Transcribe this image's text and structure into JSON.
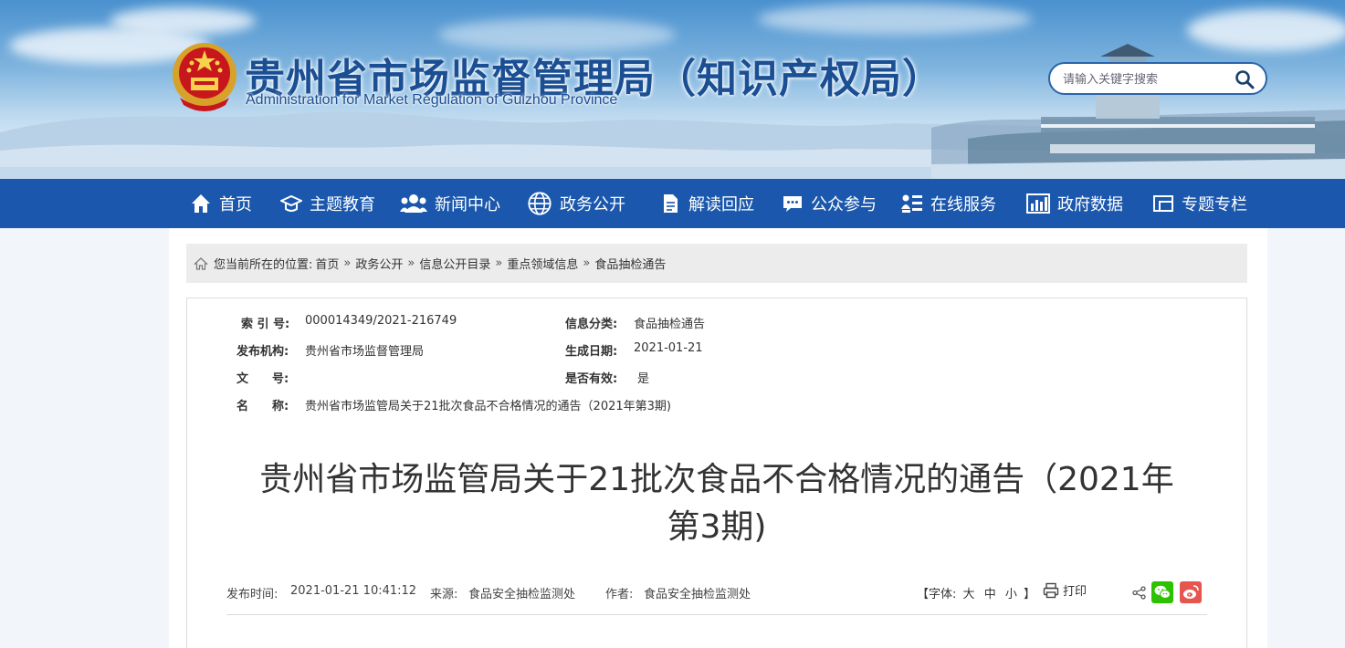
{
  "header": {
    "title": "贵州省市场监督管理局（知识产权局）",
    "subtitle": "Administration for Market Regulation of Guizhou Province",
    "search_placeholder": "请输入关键字搜索"
  },
  "nav": {
    "items": [
      {
        "label": "首页",
        "icon": "home-icon"
      },
      {
        "label": "主题教育",
        "icon": "graduation-cap-icon"
      },
      {
        "label": "新闻中心",
        "icon": "people-icon"
      },
      {
        "label": "政务公开",
        "icon": "globe-icon"
      },
      {
        "label": "解读回应",
        "icon": "document-icon"
      },
      {
        "label": "公众参与",
        "icon": "chat-bubble-icon"
      },
      {
        "label": "在线服务",
        "icon": "user-list-icon"
      },
      {
        "label": "政府数据",
        "icon": "bar-chart-icon"
      },
      {
        "label": "专题专栏",
        "icon": "window-icon"
      }
    ]
  },
  "breadcrumb": {
    "prefix": "您当前所在的位置:",
    "items": [
      "首页",
      "政务公开",
      "信息公开目录",
      "重点领域信息",
      "食品抽检通告"
    ],
    "separator": "»"
  },
  "meta": {
    "index_label": "索 引 号:",
    "index_value": "000014349/2021-216749",
    "category_label": "信息分类:",
    "category_value": "食品抽检通告",
    "publisher_label": "发布机构:",
    "publisher_value": "贵州省市场监督管理局",
    "date_label": "生成日期:",
    "date_value": "2021-01-21",
    "doc_no_label": "文　　号:",
    "doc_no_value": "",
    "valid_label": "是否有效:",
    "valid_value": "是",
    "name_label": "名　　称:",
    "name_value": "贵州省市场监管局关于21批次食品不合格情况的通告（2021年第3期)"
  },
  "article": {
    "title_line1": "贵州省市场监管局关于21批次食品不合格情况的通告（2021年",
    "title_line2": "第3期)",
    "publish_time_label": "发布时间:",
    "publish_time": "2021-01-21 10:41:12",
    "source_label": "来源:",
    "source": "食品安全抽检监测处",
    "author_label": "作者:",
    "author": "食品安全抽检监测处"
  },
  "tools": {
    "font_label_open": "【字体:",
    "font_large": "大",
    "font_medium": "中",
    "font_small": "小",
    "font_label_close": "】",
    "print_label": "打印"
  },
  "colors": {
    "nav_bg": "#1b58ad",
    "title_blue": "#1b4f94",
    "wechat_green": "#2dc100",
    "weibo_red": "#e6564e"
  }
}
